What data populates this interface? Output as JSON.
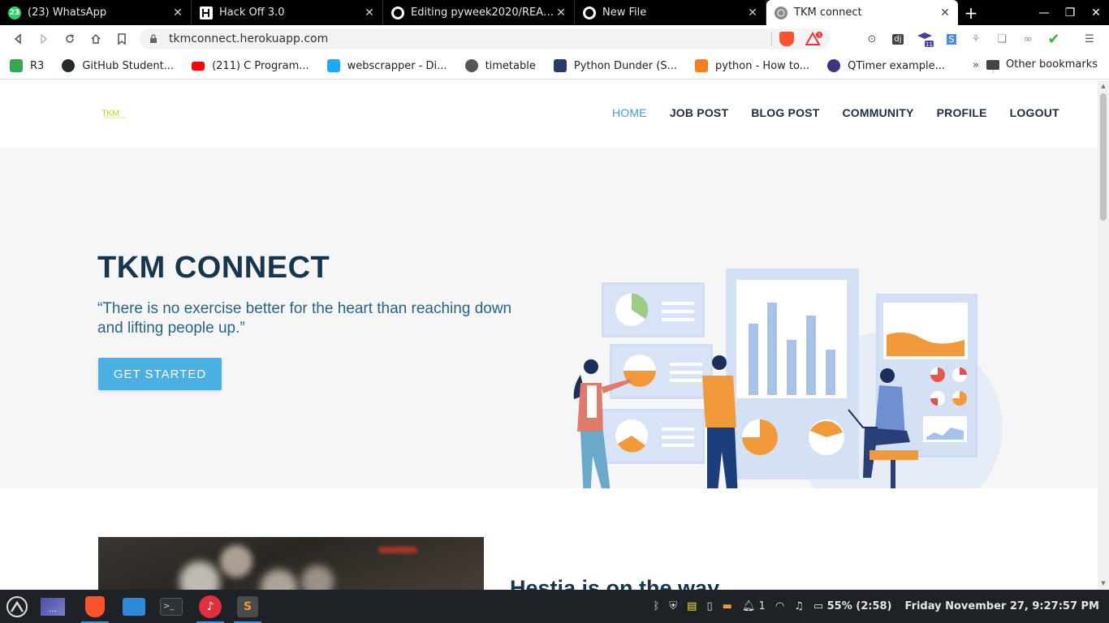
{
  "browser": {
    "tabs": [
      {
        "title": "(23) WhatsApp",
        "favicon_badge": "23",
        "favicon_color": "#25d366",
        "active": false
      },
      {
        "title": "Hack Off 3.0",
        "favicon_badge": "",
        "favicon_color": "#ffffff",
        "active": false
      },
      {
        "title": "Editing pyweek2020/README.md",
        "favicon_badge": "",
        "favicon_color": "#ffffff",
        "active": false
      },
      {
        "title": "New File",
        "favicon_badge": "",
        "favicon_color": "#ffffff",
        "active": false
      },
      {
        "title": "TKM connect",
        "favicon_badge": "",
        "favicon_color": "#888888",
        "active": true
      }
    ],
    "new_tab": "+",
    "url": "tkmconnect.herokuapp.com",
    "rewards_badge": "3",
    "extensions": {
      "badge_11": "11"
    },
    "bookmarks": [
      {
        "label": "R3",
        "icon_color": "#34a853"
      },
      {
        "label": "GitHub Student...",
        "icon_color": "#24292e"
      },
      {
        "label": "(211) C Program...",
        "icon_color": "#ff0000"
      },
      {
        "label": "webscrapper - Di...",
        "icon_color": "#1ea7fd"
      },
      {
        "label": "timetable",
        "icon_color": "#555555"
      },
      {
        "label": "Python Dunder (S...",
        "icon_color": "#2b3a67"
      },
      {
        "label": "python - How to...",
        "icon_color": "#f48024"
      },
      {
        "label": "QTimer example...",
        "icon_color": "#41317e"
      }
    ],
    "bookmarks_more": "»",
    "other_bookmarks": "Other bookmarks"
  },
  "site": {
    "logo_text": "TKM",
    "nav": [
      {
        "label": "HOME",
        "active": true
      },
      {
        "label": "JOB POST",
        "active": false
      },
      {
        "label": "BLOG POST",
        "active": false
      },
      {
        "label": "COMMUNITY",
        "active": false
      },
      {
        "label": "PROFILE",
        "active": false
      },
      {
        "label": "LOGOUT",
        "active": false
      }
    ],
    "hero": {
      "title": "TKM CONNECT",
      "quote": "“There is no exercise better for the heart than reaching down and lifting people up.”",
      "cta": "GET STARTED"
    },
    "section2_heading": "Hestia is on the way"
  },
  "taskbar": {
    "battery": "55% (2:58)",
    "clock": "Friday November 27,  9:27:57 PM",
    "notifications": "1"
  },
  "colors": {
    "accent": "#3d9fd6",
    "heading": "#16364d",
    "cta": "#4aafe3"
  }
}
